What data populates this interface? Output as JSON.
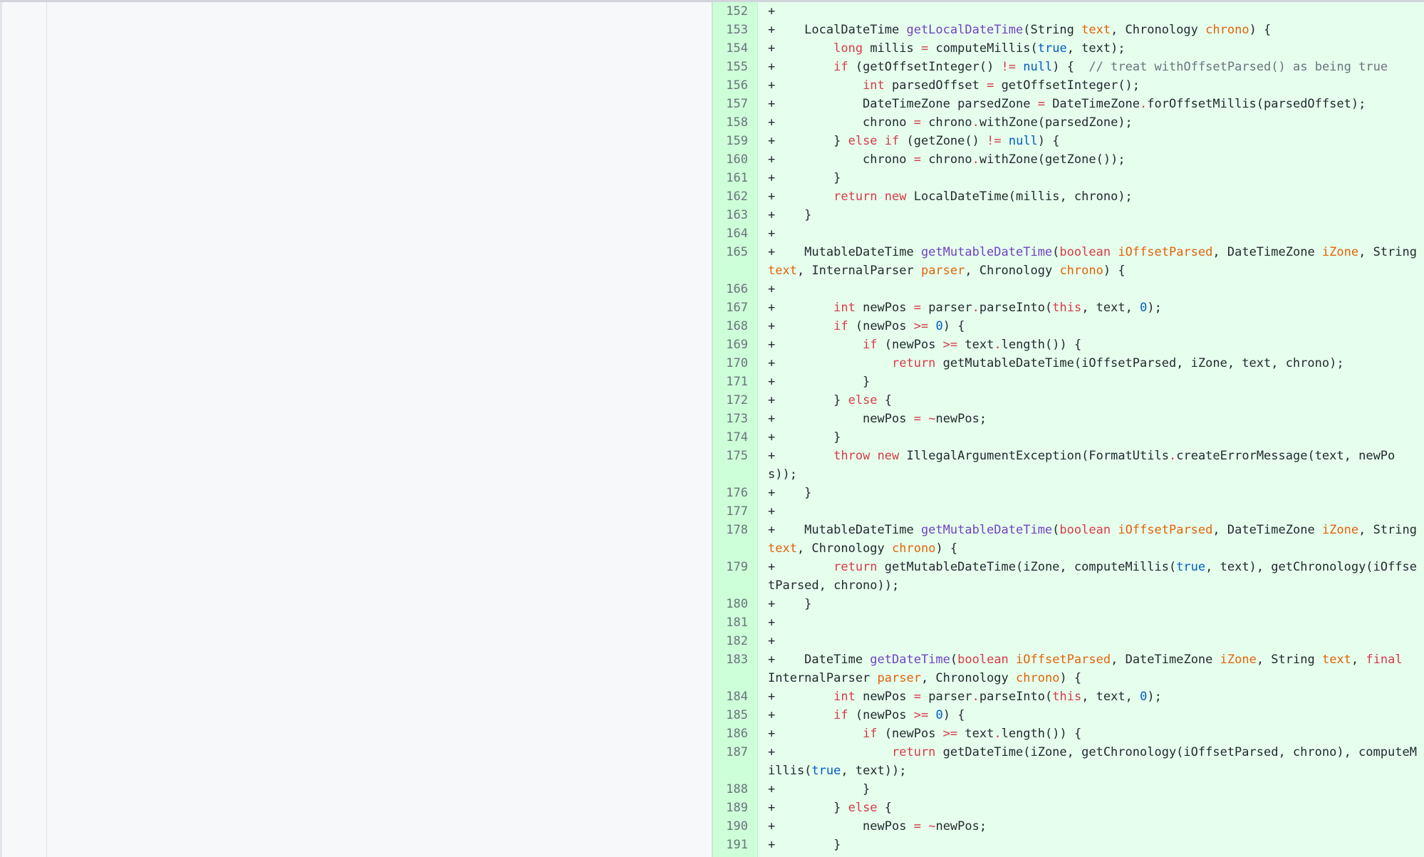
{
  "diff": {
    "rows": [
      {
        "ln": "152",
        "tokens": [
          {
            "t": "+"
          }
        ]
      },
      {
        "ln": "153",
        "tokens": [
          {
            "t": "+    LocalDateTime "
          },
          {
            "t": "getLocalDateTime",
            "c": "fn"
          },
          {
            "t": "(String "
          },
          {
            "t": "text",
            "c": "param"
          },
          {
            "t": ", Chronology "
          },
          {
            "t": "chrono",
            "c": "param"
          },
          {
            "t": ") {"
          }
        ]
      },
      {
        "ln": "154",
        "tokens": [
          {
            "t": "+        "
          },
          {
            "t": "long",
            "c": "kw"
          },
          {
            "t": " millis "
          },
          {
            "t": "=",
            "c": "kw"
          },
          {
            "t": " computeMillis("
          },
          {
            "t": "true",
            "c": "const"
          },
          {
            "t": ", text);"
          }
        ]
      },
      {
        "ln": "155",
        "tokens": [
          {
            "t": "+        "
          },
          {
            "t": "if",
            "c": "kw"
          },
          {
            "t": " (getOffsetInteger() "
          },
          {
            "t": "!=",
            "c": "kw"
          },
          {
            "t": " "
          },
          {
            "t": "null",
            "c": "const"
          },
          {
            "t": ") {  "
          },
          {
            "t": "// treat withOffsetParsed() as being true",
            "c": "cm"
          }
        ]
      },
      {
        "ln": "156",
        "tokens": [
          {
            "t": "+            "
          },
          {
            "t": "int",
            "c": "kw"
          },
          {
            "t": " parsedOffset "
          },
          {
            "t": "=",
            "c": "kw"
          },
          {
            "t": " getOffsetInteger();"
          }
        ]
      },
      {
        "ln": "157",
        "tokens": [
          {
            "t": "+            DateTimeZone parsedZone "
          },
          {
            "t": "=",
            "c": "kw"
          },
          {
            "t": " DateTimeZone"
          },
          {
            "t": ".",
            "c": "kw"
          },
          {
            "t": "forOffsetMillis(parsedOffset);"
          }
        ]
      },
      {
        "ln": "158",
        "tokens": [
          {
            "t": "+            chrono "
          },
          {
            "t": "=",
            "c": "kw"
          },
          {
            "t": " chrono"
          },
          {
            "t": ".",
            "c": "kw"
          },
          {
            "t": "withZone(parsedZone);"
          }
        ]
      },
      {
        "ln": "159",
        "tokens": [
          {
            "t": "+        } "
          },
          {
            "t": "else",
            "c": "kw"
          },
          {
            "t": " "
          },
          {
            "t": "if",
            "c": "kw"
          },
          {
            "t": " (getZone() "
          },
          {
            "t": "!=",
            "c": "kw"
          },
          {
            "t": " "
          },
          {
            "t": "null",
            "c": "const"
          },
          {
            "t": ") {"
          }
        ]
      },
      {
        "ln": "160",
        "tokens": [
          {
            "t": "+            chrono "
          },
          {
            "t": "=",
            "c": "kw"
          },
          {
            "t": " chrono"
          },
          {
            "t": ".",
            "c": "kw"
          },
          {
            "t": "withZone(getZone());"
          }
        ]
      },
      {
        "ln": "161",
        "tokens": [
          {
            "t": "+        }"
          }
        ]
      },
      {
        "ln": "162",
        "tokens": [
          {
            "t": "+        "
          },
          {
            "t": "return",
            "c": "kw"
          },
          {
            "t": " "
          },
          {
            "t": "new",
            "c": "kw"
          },
          {
            "t": " LocalDateTime(millis, chrono);"
          }
        ]
      },
      {
        "ln": "163",
        "tokens": [
          {
            "t": "+    }"
          }
        ]
      },
      {
        "ln": "164",
        "tokens": [
          {
            "t": "+"
          }
        ]
      },
      {
        "ln": "165",
        "tokens": [
          {
            "t": "+    MutableDateTime "
          },
          {
            "t": "getMutableDateTime",
            "c": "fn"
          },
          {
            "t": "("
          },
          {
            "t": "boolean",
            "c": "kw"
          },
          {
            "t": " "
          },
          {
            "t": "iOffsetParsed",
            "c": "param"
          },
          {
            "t": ", DateTimeZone "
          },
          {
            "t": "iZone",
            "c": "param"
          },
          {
            "t": ", String "
          },
          {
            "t": "text",
            "c": "param"
          },
          {
            "t": ", InternalParser "
          },
          {
            "t": "parser",
            "c": "param"
          },
          {
            "t": ", Chronology "
          },
          {
            "t": "chrono",
            "c": "param"
          },
          {
            "t": ") {"
          }
        ]
      },
      {
        "ln": "166",
        "tokens": [
          {
            "t": "+"
          }
        ]
      },
      {
        "ln": "167",
        "tokens": [
          {
            "t": "+        "
          },
          {
            "t": "int",
            "c": "kw"
          },
          {
            "t": " newPos "
          },
          {
            "t": "=",
            "c": "kw"
          },
          {
            "t": " parser"
          },
          {
            "t": ".",
            "c": "kw"
          },
          {
            "t": "parseInto("
          },
          {
            "t": "this",
            "c": "kw"
          },
          {
            "t": ", text, "
          },
          {
            "t": "0",
            "c": "const"
          },
          {
            "t": ");"
          }
        ]
      },
      {
        "ln": "168",
        "tokens": [
          {
            "t": "+        "
          },
          {
            "t": "if",
            "c": "kw"
          },
          {
            "t": " (newPos "
          },
          {
            "t": ">=",
            "c": "kw"
          },
          {
            "t": " "
          },
          {
            "t": "0",
            "c": "const"
          },
          {
            "t": ") {"
          }
        ]
      },
      {
        "ln": "169",
        "tokens": [
          {
            "t": "+            "
          },
          {
            "t": "if",
            "c": "kw"
          },
          {
            "t": " (newPos "
          },
          {
            "t": ">=",
            "c": "kw"
          },
          {
            "t": " text"
          },
          {
            "t": ".",
            "c": "kw"
          },
          {
            "t": "length()) {"
          }
        ]
      },
      {
        "ln": "170",
        "tokens": [
          {
            "t": "+                "
          },
          {
            "t": "return",
            "c": "kw"
          },
          {
            "t": " getMutableDateTime(iOffsetParsed, iZone, text, chrono);"
          }
        ]
      },
      {
        "ln": "171",
        "tokens": [
          {
            "t": "+            }"
          }
        ]
      },
      {
        "ln": "172",
        "tokens": [
          {
            "t": "+        } "
          },
          {
            "t": "else",
            "c": "kw"
          },
          {
            "t": " {"
          }
        ]
      },
      {
        "ln": "173",
        "tokens": [
          {
            "t": "+            newPos "
          },
          {
            "t": "=",
            "c": "kw"
          },
          {
            "t": " "
          },
          {
            "t": "~",
            "c": "kw"
          },
          {
            "t": "newPos;"
          }
        ]
      },
      {
        "ln": "174",
        "tokens": [
          {
            "t": "+        }"
          }
        ]
      },
      {
        "ln": "175",
        "tokens": [
          {
            "t": "+        "
          },
          {
            "t": "throw",
            "c": "kw"
          },
          {
            "t": " "
          },
          {
            "t": "new",
            "c": "kw"
          },
          {
            "t": " IllegalArgumentException(FormatUtils"
          },
          {
            "t": ".",
            "c": "kw"
          },
          {
            "t": "createErrorMessage(text, newPos));"
          }
        ]
      },
      {
        "ln": "176",
        "tokens": [
          {
            "t": "+    }"
          }
        ]
      },
      {
        "ln": "177",
        "tokens": [
          {
            "t": "+"
          }
        ]
      },
      {
        "ln": "178",
        "tokens": [
          {
            "t": "+    MutableDateTime "
          },
          {
            "t": "getMutableDateTime",
            "c": "fn"
          },
          {
            "t": "("
          },
          {
            "t": "boolean",
            "c": "kw"
          },
          {
            "t": " "
          },
          {
            "t": "iOffsetParsed",
            "c": "param"
          },
          {
            "t": ", DateTimeZone "
          },
          {
            "t": "iZone",
            "c": "param"
          },
          {
            "t": ", String "
          },
          {
            "t": "text",
            "c": "param"
          },
          {
            "t": ", Chronology "
          },
          {
            "t": "chrono",
            "c": "param"
          },
          {
            "t": ") {"
          }
        ]
      },
      {
        "ln": "179",
        "tokens": [
          {
            "t": "+        "
          },
          {
            "t": "return",
            "c": "kw"
          },
          {
            "t": " getMutableDateTime(iZone, computeMillis("
          },
          {
            "t": "true",
            "c": "const"
          },
          {
            "t": ", text), getChronology(iOffsetParsed, chrono));"
          }
        ]
      },
      {
        "ln": "180",
        "tokens": [
          {
            "t": "+    }"
          }
        ]
      },
      {
        "ln": "181",
        "tokens": [
          {
            "t": "+"
          }
        ]
      },
      {
        "ln": "182",
        "tokens": [
          {
            "t": "+"
          }
        ]
      },
      {
        "ln": "183",
        "tokens": [
          {
            "t": "+    DateTime "
          },
          {
            "t": "getDateTime",
            "c": "fn"
          },
          {
            "t": "("
          },
          {
            "t": "boolean",
            "c": "kw"
          },
          {
            "t": " "
          },
          {
            "t": "iOffsetParsed",
            "c": "param"
          },
          {
            "t": ", DateTimeZone "
          },
          {
            "t": "iZone",
            "c": "param"
          },
          {
            "t": ", String "
          },
          {
            "t": "text",
            "c": "param"
          },
          {
            "t": ", "
          },
          {
            "t": "final",
            "c": "kw"
          },
          {
            "t": " InternalParser "
          },
          {
            "t": "parser",
            "c": "param"
          },
          {
            "t": ", Chronology "
          },
          {
            "t": "chrono",
            "c": "param"
          },
          {
            "t": ") {"
          }
        ]
      },
      {
        "ln": "184",
        "tokens": [
          {
            "t": "+        "
          },
          {
            "t": "int",
            "c": "kw"
          },
          {
            "t": " newPos "
          },
          {
            "t": "=",
            "c": "kw"
          },
          {
            "t": " parser"
          },
          {
            "t": ".",
            "c": "kw"
          },
          {
            "t": "parseInto("
          },
          {
            "t": "this",
            "c": "kw"
          },
          {
            "t": ", text, "
          },
          {
            "t": "0",
            "c": "const"
          },
          {
            "t": ");"
          }
        ]
      },
      {
        "ln": "185",
        "tokens": [
          {
            "t": "+        "
          },
          {
            "t": "if",
            "c": "kw"
          },
          {
            "t": " (newPos "
          },
          {
            "t": ">=",
            "c": "kw"
          },
          {
            "t": " "
          },
          {
            "t": "0",
            "c": "const"
          },
          {
            "t": ") {"
          }
        ]
      },
      {
        "ln": "186",
        "tokens": [
          {
            "t": "+            "
          },
          {
            "t": "if",
            "c": "kw"
          },
          {
            "t": " (newPos "
          },
          {
            "t": ">=",
            "c": "kw"
          },
          {
            "t": " text"
          },
          {
            "t": ".",
            "c": "kw"
          },
          {
            "t": "length()) {"
          }
        ]
      },
      {
        "ln": "187",
        "tokens": [
          {
            "t": "+                "
          },
          {
            "t": "return",
            "c": "kw"
          },
          {
            "t": " getDateTime(iZone, getChronology(iOffsetParsed, chrono), computeMillis("
          },
          {
            "t": "true",
            "c": "const"
          },
          {
            "t": ", text));"
          }
        ]
      },
      {
        "ln": "188",
        "tokens": [
          {
            "t": "+            }"
          }
        ]
      },
      {
        "ln": "189",
        "tokens": [
          {
            "t": "+        } "
          },
          {
            "t": "else",
            "c": "kw"
          },
          {
            "t": " {"
          }
        ]
      },
      {
        "ln": "190",
        "tokens": [
          {
            "t": "+            newPos "
          },
          {
            "t": "=",
            "c": "kw"
          },
          {
            "t": " "
          },
          {
            "t": "~",
            "c": "kw"
          },
          {
            "t": "newPos;"
          }
        ]
      },
      {
        "ln": "191",
        "tokens": [
          {
            "t": "+        }"
          }
        ]
      }
    ]
  }
}
